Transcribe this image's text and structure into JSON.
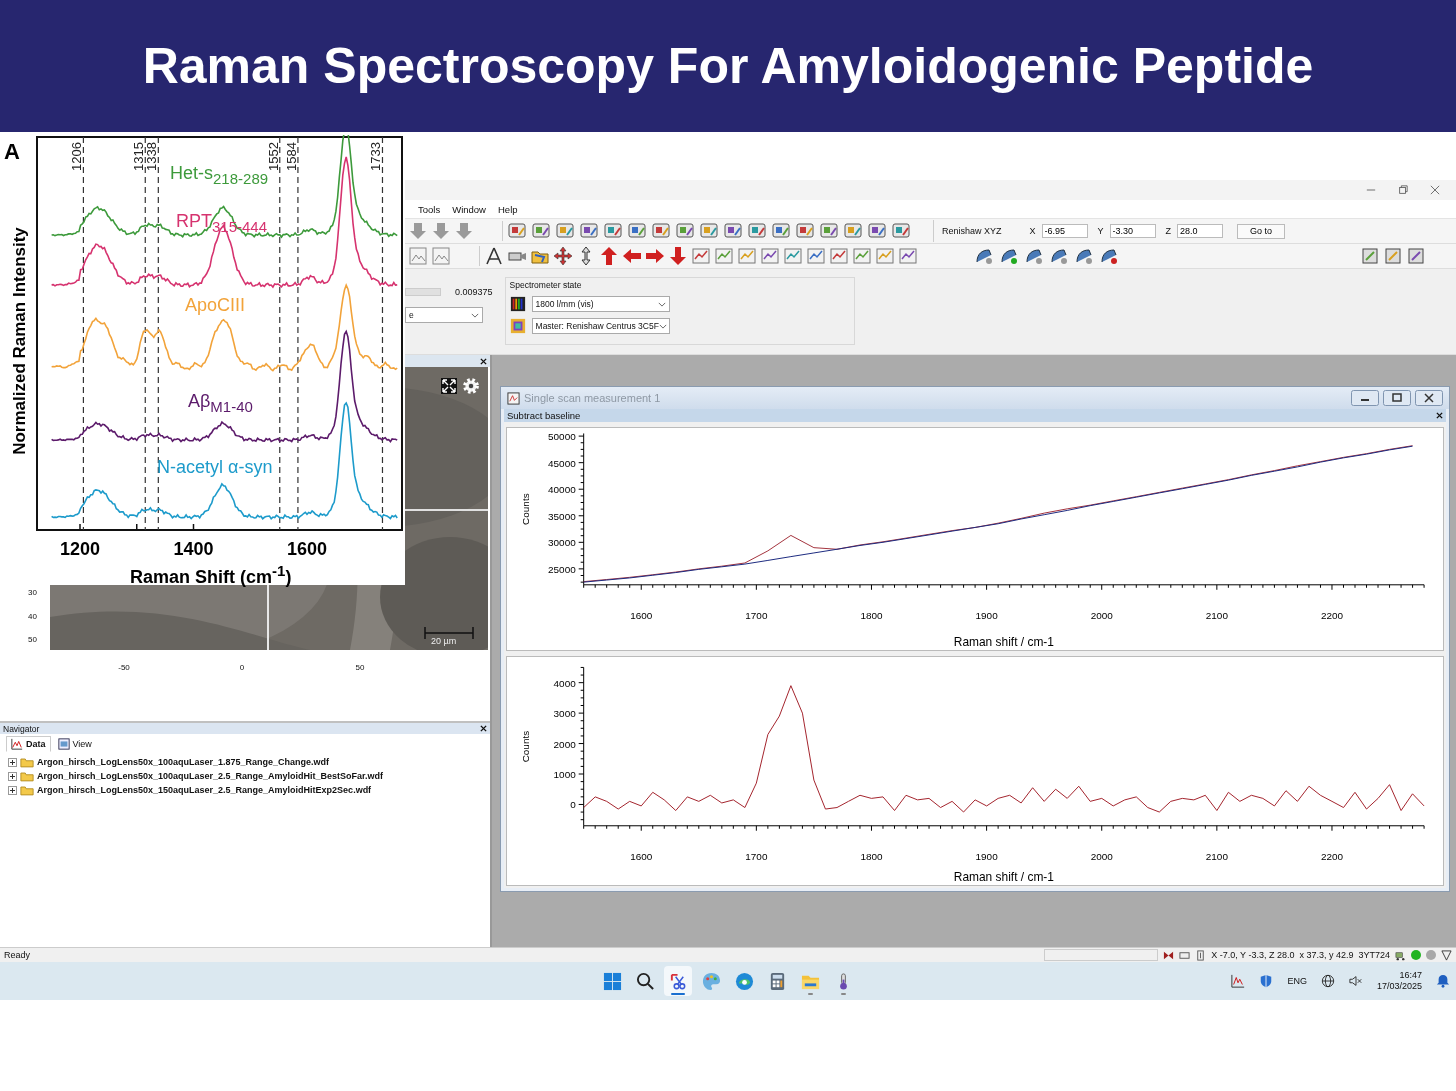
{
  "slide_title": "Raman Spectroscopy For Amyloidogenic Peptide",
  "figure": {
    "panel_label": "A",
    "ylabel": "Normalized Raman Intensity",
    "xlabel": "Raman Shift (cm$^{-1}$)",
    "xticks": [
      "1200",
      "1400",
      "1600"
    ],
    "marker_lines": [
      "1206",
      "1315",
      "1338",
      "1552",
      "1584",
      "1733"
    ],
    "series": [
      {
        "label": "Het-s$_{218-289}$",
        "color": "#3d9a3b"
      },
      {
        "label": "RPT$_{315-444}$",
        "color": "#d6336f"
      },
      {
        "label": "ApoCIII",
        "color": "#f2a33a"
      },
      {
        "label": "Aβ$_{M1-40}$",
        "color": "#5c1b6b"
      },
      {
        "label": "N-acetyl α-syn",
        "color": "#1d9bcb"
      }
    ]
  },
  "menu": [
    "Tools",
    "Window",
    "Help"
  ],
  "stage": {
    "label": "Renishaw XYZ",
    "fields": [
      {
        "label": "X",
        "value": "-6.95"
      },
      {
        "label": "Y",
        "value": "-3.30"
      },
      {
        "label": "Z",
        "value": "28.0"
      }
    ],
    "button": "Go to"
  },
  "exposure": {
    "value": "0.009375",
    "dropdown": "e"
  },
  "spectrometer_state": {
    "title": "Spectrometer state",
    "grating": "1800 l/mm (vis)",
    "detector": "Master: Renishaw Centrus 3C5F"
  },
  "video": {
    "y_ticks": [
      "30",
      "40",
      "50"
    ],
    "x_ticks": [
      "-50",
      "0",
      "50"
    ],
    "scale_bar": "20 µm"
  },
  "navigator": {
    "title": "Navigator",
    "tabs": [
      {
        "label": "Data",
        "selected": true
      },
      {
        "label": "View",
        "selected": false
      }
    ],
    "files": [
      {
        "name": "Argon_hirsch_LogLens50x_100aquLaser_1.875_Range_Change.wdf",
        "expanded": false
      },
      {
        "name": "Argon_hirsch_LogLens50x_100aquLaser_2.5_Range_AmyloidHit_BestSoFar.wdf",
        "expanded": false
      },
      {
        "name": "Argon_hirsch_LogLens50x_150aquLaser_2.5_Range_AmyloidHitExp2Sec.wdf",
        "expanded": false
      }
    ]
  },
  "measurement": {
    "title": "Single scan measurement 1",
    "panel": "Subtract baseline",
    "charts": [
      {
        "chart_data": {
          "type": "line",
          "xlabel": "Raman shift / cm-1",
          "ylabel": "Counts",
          "xlim": [
            1550,
            2280
          ],
          "ylim": [
            22000,
            50500
          ],
          "xticks": [
            1600,
            1700,
            1800,
            1900,
            2000,
            2100,
            2200
          ],
          "yticks": [
            25000,
            30000,
            35000,
            40000,
            45000,
            50000
          ],
          "x": [
            1550,
            1570,
            1590,
            1610,
            1630,
            1650,
            1670,
            1690,
            1710,
            1730,
            1750,
            1770,
            1790,
            1810,
            1830,
            1850,
            1870,
            1890,
            1910,
            1930,
            1950,
            1970,
            1990,
            2010,
            2030,
            2050,
            2070,
            2090,
            2110,
            2130,
            2150,
            2170,
            2190,
            2210,
            2230,
            2250,
            2270
          ],
          "series": [
            {
              "color": "#a3323c",
              "values": [
                22600,
                23000,
                23400,
                23900,
                24400,
                25000,
                25500,
                26100,
                28400,
                31300,
                29000,
                28700,
                29500,
                30100,
                30800,
                31500,
                32200,
                32800,
                33600,
                34500,
                35500,
                36300,
                37000,
                37800,
                38600,
                39400,
                40200,
                41000,
                41800,
                42700,
                43500,
                44400,
                45200,
                46000,
                46700,
                47500,
                48200
              ]
            },
            {
              "color": "#1c2a80",
              "values": [
                22500,
                22900,
                23300,
                23800,
                24300,
                24900,
                25400,
                25900,
                26600,
                27300,
                28000,
                28700,
                29400,
                30000,
                30700,
                31400,
                32100,
                32800,
                33500,
                34400,
                35200,
                36000,
                36900,
                37700,
                38500,
                39300,
                40100,
                40900,
                41700,
                42600,
                43400,
                44200,
                45100,
                45900,
                46600,
                47400,
                48100
              ]
            }
          ]
        }
      },
      {
        "chart_data": {
          "type": "line",
          "xlabel": "Raman shift / cm-1",
          "ylabel": "Counts",
          "xlim": [
            1550,
            2280
          ],
          "ylim": [
            -700,
            4500
          ],
          "xticks": [
            1600,
            1700,
            1800,
            1900,
            2000,
            2100,
            2200
          ],
          "yticks": [
            0,
            1000,
            2000,
            3000,
            4000
          ],
          "x": [
            1550,
            1560,
            1570,
            1580,
            1590,
            1600,
            1610,
            1620,
            1630,
            1640,
            1650,
            1660,
            1670,
            1680,
            1690,
            1700,
            1710,
            1720,
            1730,
            1740,
            1750,
            1760,
            1770,
            1780,
            1790,
            1800,
            1810,
            1820,
            1830,
            1840,
            1850,
            1860,
            1870,
            1880,
            1890,
            1900,
            1910,
            1920,
            1930,
            1940,
            1950,
            1960,
            1970,
            1980,
            1990,
            2000,
            2010,
            2020,
            2030,
            2040,
            2050,
            2060,
            2070,
            2080,
            2090,
            2100,
            2110,
            2120,
            2130,
            2140,
            2150,
            2160,
            2170,
            2180,
            2190,
            2200,
            2210,
            2220,
            2230,
            2240,
            2250,
            2260,
            2270,
            2280
          ],
          "series": [
            {
              "color": "#a3232c",
              "values": [
                -100,
                250,
                100,
                -150,
                100,
                -50,
                400,
                150,
                -200,
                250,
                100,
                300,
                50,
                150,
                -100,
                700,
                2300,
                2900,
                3900,
                3000,
                800,
                -150,
                -100,
                100,
                300,
                200,
                250,
                -200,
                300,
                150,
                200,
                -100,
                100,
                -250,
                150,
                -50,
                200,
                300,
                50,
                550,
                100,
                500,
                200,
                600,
                100,
                200,
                -50,
                150,
                250,
                -100,
                -250,
                100,
                200,
                150,
                300,
                -200,
                400,
                100,
                300,
                200,
                -50,
                450,
                100,
                600,
                300,
                100,
                -100,
                400,
                -150,
                200,
                650,
                -200,
                350,
                -50
              ]
            }
          ]
        }
      }
    ]
  },
  "status_bar": {
    "message": "Ready",
    "position": "X -7.0, Y -3.3, Z 28.0",
    "pixel": "x 37.3, y 42.9",
    "code": "3YT724",
    "indicators": [
      {
        "color": "#22b422"
      },
      {
        "color": "#a8a8a8"
      }
    ]
  },
  "taskbar": {
    "apps": [
      {
        "kind": "start",
        "selected": false,
        "running": false
      },
      {
        "kind": "search",
        "selected": false,
        "running": false
      },
      {
        "kind": "snip",
        "selected": true,
        "running": true
      },
      {
        "kind": "paint",
        "selected": false,
        "running": false
      },
      {
        "kind": "browser",
        "selected": false,
        "running": false
      },
      {
        "kind": "calculator",
        "selected": false,
        "running": false
      },
      {
        "kind": "folder",
        "selected": false,
        "running": true
      },
      {
        "kind": "thermo",
        "selected": false,
        "running": true
      }
    ],
    "language": "ENG",
    "time": "16:47",
    "date": "17/03/2025"
  }
}
